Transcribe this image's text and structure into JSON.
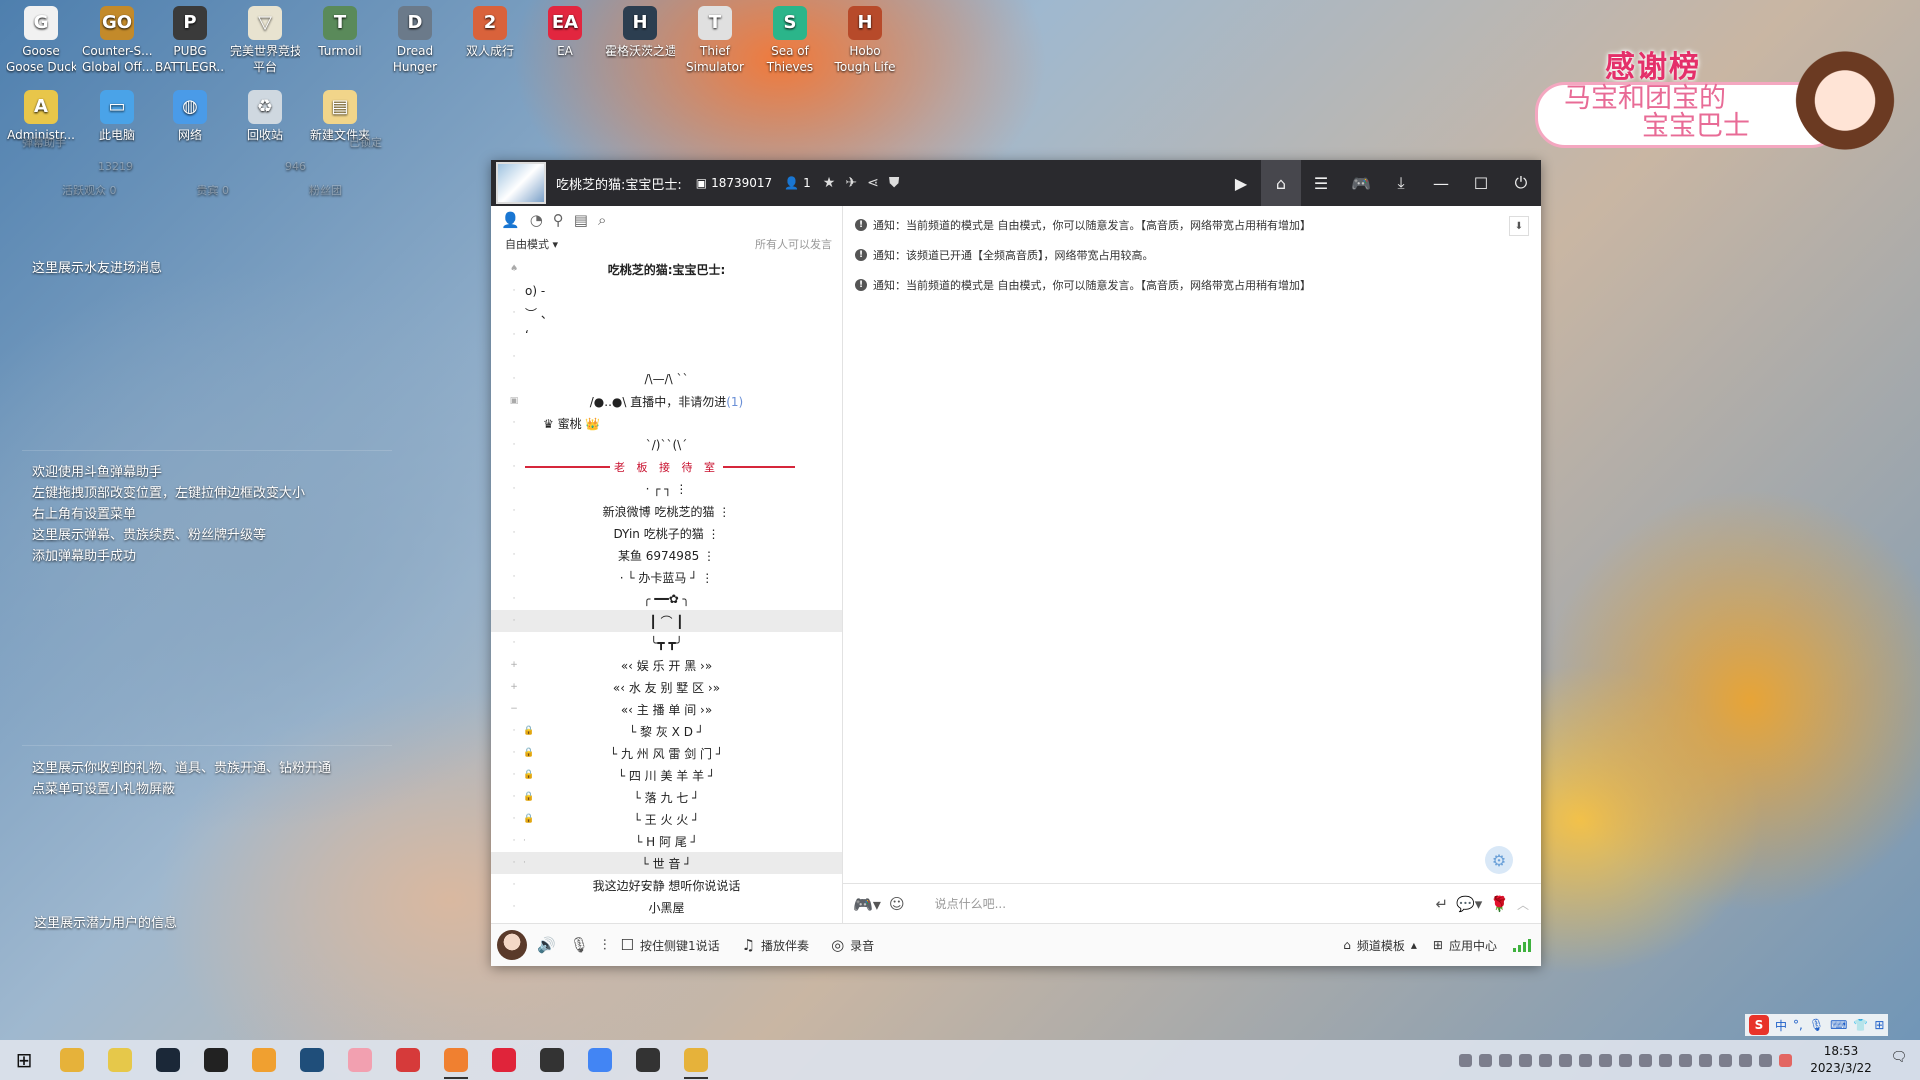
{
  "desktop": {
    "icons": [
      {
        "label": "Goose",
        "label2": "Goose Duck",
        "glyph": "G",
        "color": "#f1f1f1"
      },
      {
        "label": "Counter-S...",
        "label2": "Global Off...",
        "glyph": "GO",
        "color": "#c38a2a"
      },
      {
        "label": "PUBG",
        "label2": "BATTLEGR...",
        "glyph": "P",
        "color": "#3a3a3a"
      },
      {
        "label": "完美世界竞技",
        "label2": "平台",
        "glyph": "▽",
        "color": "#e8e3d0"
      },
      {
        "label": "Turmoil",
        "label2": "",
        "glyph": "T",
        "color": "#5a8a5a"
      },
      {
        "label": "Dread",
        "label2": "Hunger",
        "glyph": "D",
        "color": "#6b7a8a"
      },
      {
        "label": "双人成行",
        "label2": "",
        "glyph": "2",
        "color": "#d9623b"
      },
      {
        "label": "EA",
        "label2": "",
        "glyph": "EA",
        "color": "#e2263f"
      },
      {
        "label": "霍格沃茨之遗",
        "label2": "",
        "glyph": "H",
        "color": "#2c3e50"
      },
      {
        "label": "Thief",
        "label2": "Simulator",
        "glyph": "T",
        "color": "#e0e0e0"
      },
      {
        "label": "Sea of",
        "label2": "Thieves",
        "glyph": "S",
        "color": "#2bb58a"
      },
      {
        "label": "Hobo",
        "label2": "Tough Life",
        "glyph": "H",
        "color": "#b74a2a"
      },
      {
        "label": "Administr...",
        "label2": "",
        "glyph": "A",
        "color": "#e8c64a"
      },
      {
        "label": "此电脑",
        "label2": "",
        "glyph": "▭",
        "color": "#4aa3e8"
      },
      {
        "label": "网络",
        "label2": "",
        "glyph": "◍",
        "color": "#4a9be8"
      },
      {
        "label": "回收站",
        "label2": "",
        "glyph": "♻",
        "color": "#cfd8e0"
      },
      {
        "label": "新建文件夹",
        "label2": "",
        "glyph": "▤",
        "color": "#f1d58a"
      }
    ]
  },
  "overlay": {
    "faint_title": "弹幕助手",
    "faint_lock": "已锁定",
    "faint_count1": "13219",
    "faint_count2": "946",
    "faint_tab1": "活跃观众 0",
    "faint_tab2": "贵宾 0",
    "faint_tab3": "粉丝团",
    "entry_msg": "这里展示水友进场消息",
    "welcome_lines": [
      "欢迎使用斗鱼弹幕助手",
      "左键拖拽顶部改变位置，左键拉伸边框改变大小",
      "右上角有设置菜单",
      "这里展示弹幕、贵族续费、粉丝牌升级等",
      "添加弹幕助手成功"
    ],
    "gift_lines": [
      "这里展示你收到的礼物、道具、贵族开通、钻粉开通",
      "点菜单可设置小礼物屏蔽"
    ],
    "potential_msg": "这里展示潜力用户的信息"
  },
  "thanks": {
    "title": "感谢榜",
    "line1": "马宝和团宝的",
    "line2": "宝宝巴士"
  },
  "window": {
    "channel_name": "吃桃芝的猫:宝宝巴士:",
    "channel_id": "18739017",
    "online": "1",
    "mode": "自由模式",
    "mode_hint": "所有人可以发言",
    "tree": [
      {
        "text": "吃桃芝的猫:宝宝巴士:",
        "style": "bold",
        "mark": "♠"
      },
      {
        "text": "o) -",
        "style": "left",
        "mark": "·"
      },
      {
        "text": "︶  、",
        "style": "left",
        "mark": "·"
      },
      {
        "text": "ʻ",
        "style": "left",
        "mark": "·"
      },
      {
        "text": "",
        "style": "",
        "mark": "·"
      },
      {
        "text": "/\\—/\\  ˋˋ",
        "style": "",
        "mark": "·"
      },
      {
        "text": "/●..●\\      直播中，非请勿进",
        "count": "(1)",
        "style": "",
        "mark": "▣"
      },
      {
        "text": "♛ 蜜桃 👑",
        "style": "user",
        "mark": "·"
      },
      {
        "text": "ˋ/)ˋˋ(\\ˊ",
        "style": "",
        "mark": "·"
      },
      {
        "text": "老 板 接 待 室",
        "style": "redline",
        "mark": "·"
      },
      {
        "text": "·  ┌                          ┐  ⋮",
        "style": "",
        "mark": "·"
      },
      {
        "text": "新浪微博          吃桃芝的猫          ⋮",
        "style": "",
        "mark": "·"
      },
      {
        "text": "DYin            吃桃子的猫          ⋮",
        "style": "",
        "mark": "·"
      },
      {
        "text": "某鱼              6974985          ⋮",
        "style": "",
        "mark": "·"
      },
      {
        "text": "·  └            办卡蓝马          ┘  ⋮",
        "style": "",
        "mark": "·"
      },
      {
        "text": "╭ ━━✿ ╮",
        "style": "",
        "mark": "·"
      },
      {
        "text": "┃  ⌒  ┃",
        "style": "hl",
        "mark": "·"
      },
      {
        "text": "╰┳  ┳╯",
        "style": "",
        "mark": "·"
      },
      {
        "text": "«‹    娱    乐    开    黑    ›»",
        "style": "",
        "mark": "+"
      },
      {
        "text": "«‹    水    友    别    墅    区    ›»",
        "style": "",
        "mark": "+"
      },
      {
        "text": "«‹    主    播    单    间    ›»",
        "style": "",
        "mark": "−"
      },
      {
        "text": "└     黎  灰  X  D     ┘",
        "style": "lock",
        "mark": "·"
      },
      {
        "text": "└ 九 州 风 雷 剑 门 ┘",
        "style": "lock",
        "mark": "·"
      },
      {
        "text": "└  四  川  美  羊  羊 ┘",
        "style": "lock",
        "mark": "·"
      },
      {
        "text": "└     落   九   七     ┘",
        "style": "lock",
        "mark": "·"
      },
      {
        "text": "└     王   火   火     ┘",
        "style": "lock",
        "mark": "·"
      },
      {
        "text": "└     H   阿   尾     ┘",
        "style": "sub",
        "mark": "·"
      },
      {
        "text": "└      世    音      ┘",
        "style": "hl-sub",
        "mark": "·"
      },
      {
        "text": "我这边好安静  想听你说说话",
        "style": "",
        "mark": "·"
      },
      {
        "text": "小黑屋",
        "style": "",
        "mark": "·"
      }
    ],
    "notices": [
      "通知：当前频道的模式是 自由模式，你可以随意发言。【高音质，网络带宽占用稍有增加】",
      "通知：该频道已开通【全频高音质】，网络带宽占用较高。",
      "通知：当前频道的模式是 自由模式，你可以随意发言。【高音质，网络带宽占用稍有增加】"
    ],
    "input_placeholder": "说点什么吧...",
    "bottom": {
      "ptt": "按住侧键1说话",
      "music": "播放伴奏",
      "record": "录音",
      "template": "频道模板",
      "app_center": "应用中心"
    }
  },
  "taskbar": {
    "ime": "中",
    "time": "18:53",
    "date": "2023/3/22",
    "apps": [
      {
        "color": "#e6b23a"
      },
      {
        "color": "#e6c84a"
      },
      {
        "color": "#1b2838"
      },
      {
        "color": "#222"
      },
      {
        "color": "#f0a030"
      },
      {
        "color": "#1f4e7a"
      },
      {
        "color": "#f2a0b0"
      },
      {
        "color": "#d63a3a"
      },
      {
        "color": "#f08030"
      },
      {
        "color": "#e0243a"
      },
      {
        "color": "#333"
      },
      {
        "color": "#4285f4"
      },
      {
        "color": "#333"
      },
      {
        "color": "#e6b23a"
      }
    ]
  }
}
